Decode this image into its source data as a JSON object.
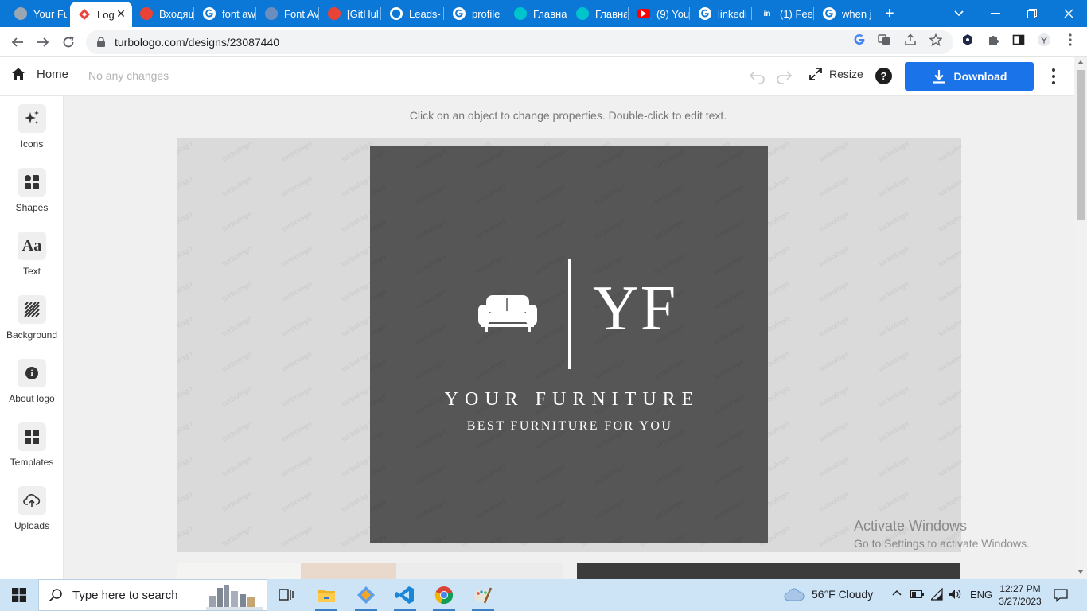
{
  "browser": {
    "tabs": [
      {
        "label": "Your Fu",
        "icon": "turbologo-icon",
        "color": "#9aa6b2"
      },
      {
        "label": "Log",
        "icon": "turbologo-diamond-icon",
        "color": "#e8453c",
        "active": true
      },
      {
        "label": "Входящ",
        "icon": "gmail-icon",
        "color": "#ea4335"
      },
      {
        "label": "font aw",
        "icon": "google-icon",
        "color": "#ffffff"
      },
      {
        "label": "Font Av",
        "icon": "flag-icon",
        "color": "#6c8ebf"
      },
      {
        "label": "[GitHul",
        "icon": "gmail-icon",
        "color": "#ea4335"
      },
      {
        "label": "Leads-",
        "icon": "github-icon",
        "color": "#ffffff"
      },
      {
        "label": "profile",
        "icon": "google-icon",
        "color": "#ffffff"
      },
      {
        "label": "Главна",
        "icon": "canva-icon",
        "color": "#00c4cc"
      },
      {
        "label": "Главна",
        "icon": "canva-icon",
        "color": "#00c4cc"
      },
      {
        "label": "(9) You",
        "icon": "youtube-icon",
        "color": "#ff0000"
      },
      {
        "label": "linkedi",
        "icon": "google-icon",
        "color": "#ffffff"
      },
      {
        "label": "(1) Fee",
        "icon": "linkedin-icon",
        "color": "#ffffff"
      },
      {
        "label": "when j",
        "icon": "google-icon",
        "color": "#ffffff"
      }
    ],
    "new_tab": "+",
    "url": "turbologo.com/designs/23087440"
  },
  "app": {
    "home_label": "Home",
    "status": "No any changes",
    "resize_label": "Resize",
    "help_label": "?",
    "download_label": "Download",
    "hint": "Click on an object to change properties. Double-click to edit text."
  },
  "sidebar": {
    "items": [
      {
        "label": "Icons",
        "icon": "sparkle-icon"
      },
      {
        "label": "Shapes",
        "icon": "shapes-icon"
      },
      {
        "label": "Text",
        "icon": "text-aa-icon",
        "glyph": "Aa"
      },
      {
        "label": "Background",
        "icon": "stripes-icon"
      },
      {
        "label": "About logo",
        "icon": "info-icon",
        "glyph": "i"
      },
      {
        "label": "Templates",
        "icon": "templates-icon"
      },
      {
        "label": "Uploads",
        "icon": "cloud-upload-icon"
      }
    ]
  },
  "logo": {
    "monogram": "YF",
    "name": "YOUR FURNITURE",
    "tagline": "BEST FURNITURE FOR YOU",
    "background_color": "#565656",
    "watermark": "turbologo"
  },
  "windows_notice": {
    "title": "Activate Windows",
    "subtitle": "Go to Settings to activate Windows."
  },
  "taskbar": {
    "search_placeholder": "Type here to search",
    "weather": "56°F  Cloudy",
    "language": "ENG",
    "time": "12:27 PM",
    "date": "3/27/2023"
  }
}
